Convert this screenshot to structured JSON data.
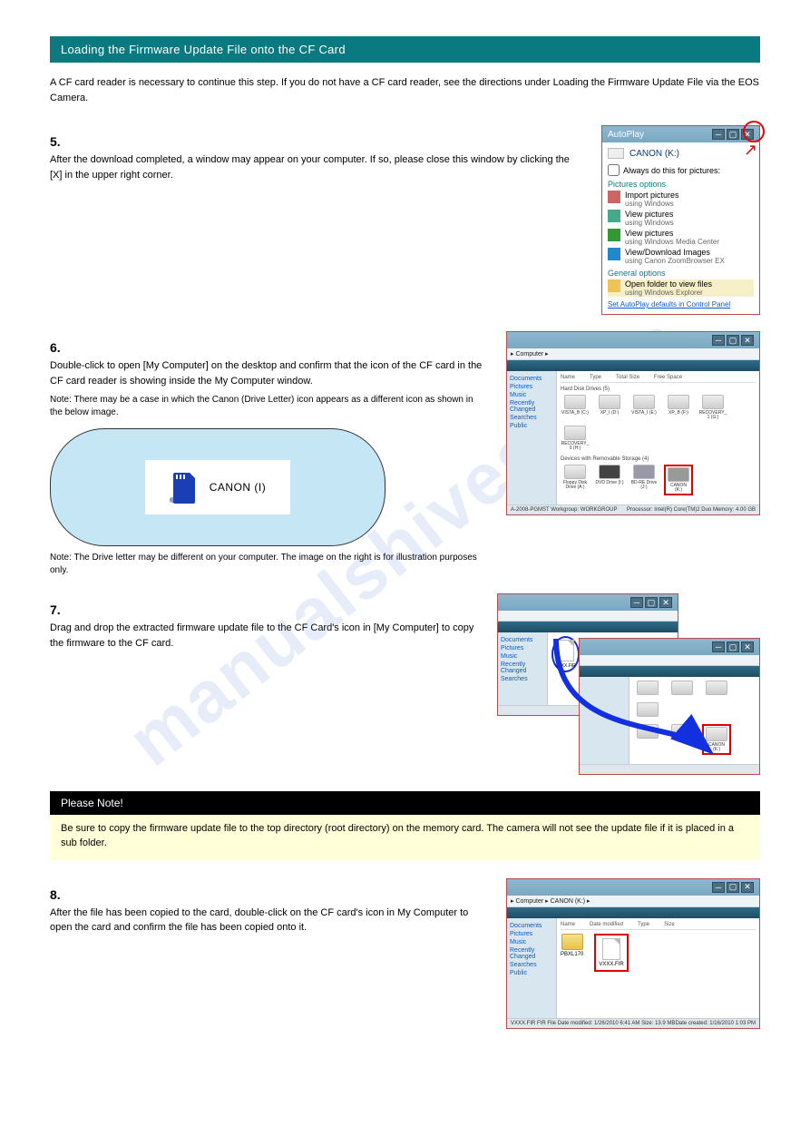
{
  "watermark": "manualshives.com",
  "section_title": "Loading the Firmware Update File onto the CF Card",
  "intro": "A CF card reader is necessary to continue this step. If you do not have a CF card reader, see the directions under Loading the Firmware Update File via the EOS Camera.",
  "step5": {
    "num": "5.",
    "text": "After the download completed, a window may appear on your computer. If so, please close this window by clicking the [X] in the upper right corner."
  },
  "step6": {
    "num": "6.",
    "text": "Double-click to open [My Computer] on the desktop and confirm that the icon of the CF card in the CF card reader is showing inside the My Computer window.",
    "note_a": "Note: There may be a case in which the Canon (Drive Letter) icon appears as a different icon as shown in the below image.",
    "note_b": "Note: The Drive letter may be different on your computer. The image on the right is for illustration purposes only."
  },
  "cloud_drive": "CANON (I)",
  "step7": {
    "num": "7.",
    "text": "Drag and drop the extracted firmware update file to the CF Card's icon in [My Computer] to copy the firmware to the CF card."
  },
  "caution": {
    "heading": "Please Note!",
    "text": "Be sure to copy the firmware update file to the top directory (root directory) on the memory card. The camera will not see the update file if it is placed in a sub folder."
  },
  "step8": {
    "num": "8.",
    "text": "After the file has been copied to the card, double-click on the CF card's icon in My Computer to open the card and confirm the file has been copied onto it."
  },
  "autoplay": {
    "title": "AutoPlay",
    "device": "CANON (K:)",
    "always": "Always do this for pictures:",
    "sec1": "Pictures options",
    "items": [
      {
        "t": "Import pictures",
        "s": "using Windows"
      },
      {
        "t": "View pictures",
        "s": "using Windows"
      },
      {
        "t": "View pictures",
        "s": "using Windows Media Center"
      },
      {
        "t": "View/Download Images",
        "s": "using Canon ZoomBrowser EX"
      }
    ],
    "sec2": "General options",
    "open_folder": {
      "t": "Open folder to view files",
      "s": "using Windows Explorer"
    },
    "link": "Set AutoPlay defaults in Control Panel"
  },
  "explorer1": {
    "addr": "▸ Computer ▸",
    "side": [
      "Documents",
      "Pictures",
      "Music",
      "Recently Changed",
      "Searches",
      "Public"
    ],
    "cols": [
      "Name",
      "Type",
      "Total Size",
      "Free Space"
    ],
    "sec1": "Hard Disk Drives (5)",
    "drives1": [
      "VISTA_B (C:)",
      "XP_I (D:)",
      "VISTA_I (E:)",
      "XP_B (F:)",
      "RECOVERY_1 (G:)",
      "RECOVERY_0 (H:)"
    ],
    "sec2": "Devices with Removable Storage (4)",
    "drives2": [
      "Floppy Disk Drive (A:)",
      "DVD Drive (I:)",
      "BD-RE Drive (J:)",
      "CANON (K:)"
    ],
    "status_l": "A-2008-PGMST   Workgroup: WORKGROUP",
    "status_r": "Processor: Intel(R) Core(TM)2 Duo   Memory: 4.00 GB"
  },
  "copy_src_file": "VXXX.FIR",
  "copy_dst_drive": "CANON (K:)",
  "explorer2": {
    "addr": "▸ Computer ▸ CANON (K:) ▸",
    "folder": "PBXL170",
    "file": "VXXX.FIR",
    "status_l": "VXXX.FIR FIR File   Date modified: 1/26/2010 6:41 AM   Size: 13.9 MB",
    "status_r": "Date created: 1/16/2010 1:03 PM"
  }
}
